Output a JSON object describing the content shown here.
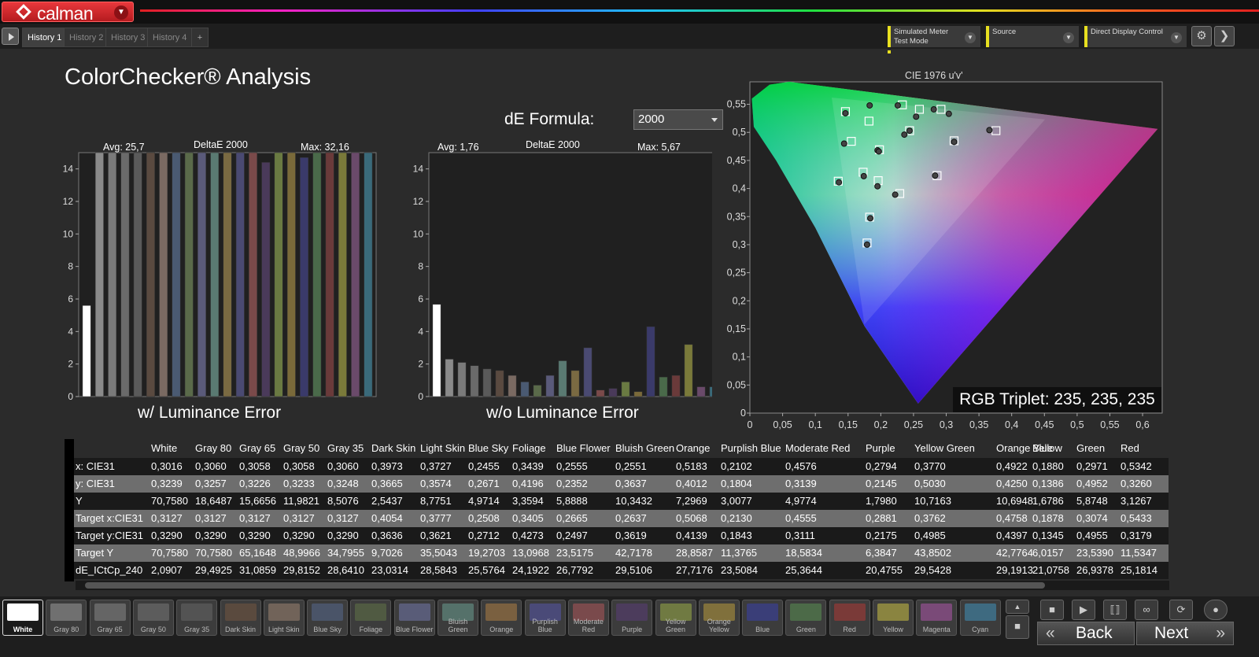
{
  "app": {
    "name": "calman"
  },
  "tabs": [
    "History 1",
    "History 2",
    "History 3",
    "History 4",
    "+"
  ],
  "header": {
    "meter_line1": "Simulated Meter",
    "meter_line2": "Test Mode",
    "source": "Source",
    "display_control": "Direct Display Control"
  },
  "title": "ColorChecker® Analysis",
  "formula": {
    "label": "dE Formula:",
    "value": "2000"
  },
  "cie_title": "CIE 1976 u'v'",
  "rgb_triplet": "RGB Triplet: 235, 235, 235",
  "colors": {
    "accent": "#e8e020",
    "brand": "#d7262a"
  },
  "chart_data": [
    {
      "type": "bar",
      "title": "w/ Luminance Error",
      "subtitle": "DeltaE 2000",
      "avg_label": "Avg: 25,7",
      "max_label": "Max: 32,16",
      "ylim": [
        0,
        15
      ],
      "yticks": [
        "0",
        "2",
        "4",
        "6",
        "8",
        "10",
        "12",
        "14"
      ],
      "categories": [
        "White",
        "Gray 80",
        "Gray 65",
        "Gray 50",
        "Gray 35",
        "Dark Skin",
        "Light Skin",
        "Blue Sky",
        "Foliage",
        "Blue Flower",
        "Bluish Green",
        "Orange",
        "Purplish Blue",
        "Moderate Red",
        "Purple",
        "Yellow Green",
        "Orange Yellow",
        "Blue",
        "Green",
        "Red",
        "Yellow",
        "Magenta",
        "Cyan"
      ],
      "values": [
        5.6,
        15,
        15,
        15,
        15,
        15,
        15,
        15,
        15,
        15,
        15,
        15,
        15,
        15,
        14.4,
        15,
        15,
        14.7,
        15,
        15,
        15,
        15,
        15
      ],
      "colors": [
        "#ffffff",
        "#8a8a8a",
        "#7a7a7a",
        "#6a6a6a",
        "#5a5a5a",
        "#5a4a40",
        "#7a6a62",
        "#4a5a72",
        "#5a6a4a",
        "#5a5a7a",
        "#5a7a72",
        "#7a6a42",
        "#4a4a72",
        "#7a4a4a",
        "#4a3a5a",
        "#6a7a42",
        "#7a6a3a",
        "#3a3a6a",
        "#4a6a4a",
        "#6a3a3a",
        "#7a7a3a",
        "#6a4a6a",
        "#3a6a7a"
      ]
    },
    {
      "type": "bar",
      "title": "w/o Luminance Error",
      "subtitle": "DeltaE 2000",
      "avg_label": "Avg: 1,76",
      "max_label": "Max: 5,67",
      "ylim": [
        0,
        15
      ],
      "yticks": [
        "0",
        "2",
        "4",
        "6",
        "8",
        "10",
        "12",
        "14"
      ],
      "categories": [
        "White",
        "Gray 80",
        "Gray 65",
        "Gray 50",
        "Gray 35",
        "Dark Skin",
        "Light Skin",
        "Blue Sky",
        "Foliage",
        "Blue Flower",
        "Bluish Green",
        "Orange",
        "Purplish Blue",
        "Moderate Red",
        "Purple",
        "Yellow Green",
        "Orange Yellow",
        "Blue",
        "Green",
        "Red",
        "Yellow",
        "Magenta",
        "Cyan"
      ],
      "values": [
        5.67,
        2.3,
        2.1,
        1.9,
        1.7,
        1.6,
        1.3,
        0.9,
        0.7,
        1.3,
        2.2,
        1.6,
        3.0,
        0.4,
        0.5,
        0.9,
        0.3,
        4.3,
        1.2,
        1.3,
        3.2,
        0.6,
        0.6
      ],
      "colors": [
        "#ffffff",
        "#8a8a8a",
        "#7a7a7a",
        "#6a6a6a",
        "#5a5a5a",
        "#5a4a40",
        "#7a6a62",
        "#4a5a72",
        "#5a6a4a",
        "#5a5a7a",
        "#5a7a72",
        "#7a6a42",
        "#4a4a72",
        "#7a4a4a",
        "#4a3a5a",
        "#6a7a42",
        "#7a6a3a",
        "#3a3a6a",
        "#4a6a4a",
        "#6a3a3a",
        "#7a7a3a",
        "#6a4a6a",
        "#3a6a7a"
      ]
    },
    {
      "type": "scatter",
      "title": "CIE 1976 u'v'",
      "xlim": [
        0,
        0.63
      ],
      "ylim": [
        0,
        0.59
      ],
      "xticks": [
        "0",
        "0,05",
        "0,1",
        "0,15",
        "0,2",
        "0,25",
        "0,3",
        "0,35",
        "0,4",
        "0,45",
        "0,5",
        "0,55",
        "0,6"
      ],
      "yticks": [
        "0",
        "0,05",
        "0,1",
        "0,15",
        "0,2",
        "0,25",
        "0,3",
        "0,35",
        "0,4",
        "0,45",
        "0,5",
        "0,55"
      ],
      "measured": [
        [
          0.195,
          0.468
        ],
        [
          0.146,
          0.534
        ],
        [
          0.183,
          0.548
        ],
        [
          0.226,
          0.548
        ],
        [
          0.254,
          0.528
        ],
        [
          0.236,
          0.496
        ],
        [
          0.197,
          0.466
        ],
        [
          0.144,
          0.48
        ],
        [
          0.136,
          0.411
        ],
        [
          0.174,
          0.422
        ],
        [
          0.195,
          0.404
        ],
        [
          0.222,
          0.389
        ],
        [
          0.283,
          0.423
        ],
        [
          0.366,
          0.504
        ],
        [
          0.312,
          0.483
        ],
        [
          0.184,
          0.347
        ],
        [
          0.179,
          0.3
        ],
        [
          0.281,
          0.541
        ],
        [
          0.304,
          0.533
        ],
        [
          0.244,
          0.503
        ]
      ],
      "targets": [
        [
          0.198,
          0.469
        ],
        [
          0.146,
          0.537
        ],
        [
          0.182,
          0.52
        ],
        [
          0.233,
          0.549
        ],
        [
          0.259,
          0.541
        ],
        [
          0.244,
          0.503
        ],
        [
          0.155,
          0.484
        ],
        [
          0.135,
          0.413
        ],
        [
          0.173,
          0.429
        ],
        [
          0.196,
          0.414
        ],
        [
          0.229,
          0.391
        ],
        [
          0.286,
          0.423
        ],
        [
          0.376,
          0.503
        ],
        [
          0.312,
          0.485
        ],
        [
          0.183,
          0.349
        ],
        [
          0.179,
          0.303
        ],
        [
          0.292,
          0.541
        ]
      ]
    }
  ],
  "table": {
    "columns": [
      "White",
      "Gray 80",
      "Gray 65",
      "Gray 50",
      "Gray 35",
      "Dark Skin",
      "Light Skin",
      "Blue Sky",
      "Foliage",
      "Blue Flower",
      "Bluish Green",
      "Orange",
      "Purplish Blue",
      "Moderate Red",
      "Purple",
      "Yellow Green",
      "Orange Yellow",
      "Blue",
      "Green",
      "Red"
    ],
    "rows": [
      {
        "label": "x: CIE31",
        "values": [
          "0,3016",
          "0,3060",
          "0,3058",
          "0,3058",
          "0,3060",
          "0,3973",
          "0,3727",
          "0,2455",
          "0,3439",
          "0,2555",
          "0,2551",
          "0,5183",
          "0,2102",
          "0,4576",
          "0,2794",
          "0,3770",
          "0,4922",
          "0,1880",
          "0,2971",
          "0,5342"
        ]
      },
      {
        "label": "y: CIE31",
        "values": [
          "0,3239",
          "0,3257",
          "0,3226",
          "0,3233",
          "0,3248",
          "0,3665",
          "0,3574",
          "0,2671",
          "0,4196",
          "0,2352",
          "0,3637",
          "0,4012",
          "0,1804",
          "0,3139",
          "0,2145",
          "0,5030",
          "0,4250",
          "0,1386",
          "0,4952",
          "0,3260"
        ]
      },
      {
        "label": "Y",
        "values": [
          "70,7580",
          "18,6487",
          "15,6656",
          "11,9821",
          "8,5076",
          "2,5437",
          "8,7751",
          "4,9714",
          "3,3594",
          "5,8888",
          "10,3432",
          "7,2969",
          "3,0077",
          "4,9774",
          "1,7980",
          "10,7163",
          "10,6948",
          "1,6786",
          "5,8748",
          "3,1267"
        ]
      },
      {
        "label": "Target x:CIE31",
        "values": [
          "0,3127",
          "0,3127",
          "0,3127",
          "0,3127",
          "0,3127",
          "0,4054",
          "0,3777",
          "0,2508",
          "0,3405",
          "0,2665",
          "0,2637",
          "0,5068",
          "0,2130",
          "0,4555",
          "0,2881",
          "0,3762",
          "0,4758",
          "0,1878",
          "0,3074",
          "0,5433"
        ]
      },
      {
        "label": "Target y:CIE31",
        "values": [
          "0,3290",
          "0,3290",
          "0,3290",
          "0,3290",
          "0,3290",
          "0,3636",
          "0,3621",
          "0,2712",
          "0,4273",
          "0,2497",
          "0,3619",
          "0,4139",
          "0,1843",
          "0,3111",
          "0,2175",
          "0,4985",
          "0,4397",
          "0,1345",
          "0,4955",
          "0,3179"
        ]
      },
      {
        "label": "Target Y",
        "values": [
          "70,7580",
          "70,7580",
          "65,1648",
          "48,9966",
          "34,7955",
          "9,7026",
          "35,5043",
          "19,2703",
          "13,0968",
          "23,5175",
          "42,7178",
          "28,8587",
          "11,3765",
          "18,5834",
          "6,3847",
          "43,8502",
          "42,7764",
          "6,0157",
          "23,5390",
          "11,5347"
        ]
      },
      {
        "label": "dE_ICtCp_240",
        "values": [
          "2,0907",
          "29,4925",
          "31,0859",
          "29,8152",
          "28,6410",
          "23,0314",
          "28,5843",
          "25,5764",
          "24,1922",
          "26,7792",
          "29,5106",
          "27,7176",
          "23,5084",
          "25,3644",
          "20,4755",
          "29,5428",
          "29,1913",
          "21,0758",
          "26,9378",
          "25,1814"
        ]
      }
    ]
  },
  "swatches": [
    {
      "label": "White",
      "color": "#ffffff"
    },
    {
      "label": "Gray 80",
      "color": "#707070"
    },
    {
      "label": "Gray 65",
      "color": "#656565"
    },
    {
      "label": "Gray 50",
      "color": "#5c5c5c"
    },
    {
      "label": "Gray 35",
      "color": "#535353"
    },
    {
      "label": "Dark Skin",
      "color": "#5a4a3e"
    },
    {
      "label": "Light Skin",
      "color": "#716359"
    },
    {
      "label": "Blue Sky",
      "color": "#4a5468"
    },
    {
      "label": "Foliage",
      "color": "#505a42"
    },
    {
      "label": "Blue Flower",
      "color": "#595c78"
    },
    {
      "label": "Bluish Green",
      "color": "#55716a"
    },
    {
      "label": "Orange",
      "color": "#7a6040"
    },
    {
      "label": "Purplish Blue",
      "color": "#4a4a78"
    },
    {
      "label": "Moderate Red",
      "color": "#7a4a4c"
    },
    {
      "label": "Purple",
      "color": "#4c3c5c"
    },
    {
      "label": "Yellow Green",
      "color": "#707a42"
    },
    {
      "label": "Orange Yellow",
      "color": "#80703c"
    },
    {
      "label": "Blue",
      "color": "#3a3e78"
    },
    {
      "label": "Green",
      "color": "#4c6a48"
    },
    {
      "label": "Red",
      "color": "#7a3a38"
    },
    {
      "label": "Yellow",
      "color": "#8a8440"
    },
    {
      "label": "Magenta",
      "color": "#7a4a78"
    },
    {
      "label": "Cyan",
      "color": "#3e6a80"
    }
  ],
  "nav": {
    "back": "Back",
    "next": "Next"
  }
}
